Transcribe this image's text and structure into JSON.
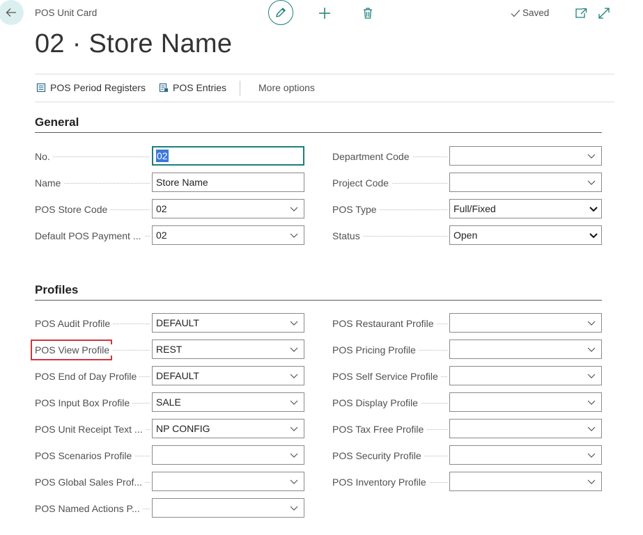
{
  "header": {
    "caption": "POS Unit Card",
    "saved_label": "Saved",
    "title": "02 · Store Name"
  },
  "actions": [
    {
      "label": "POS Period Registers",
      "icon": "register-icon"
    },
    {
      "label": "POS Entries",
      "icon": "entries-icon"
    },
    {
      "label": "More options"
    }
  ],
  "general": {
    "title": "General",
    "left": [
      {
        "label": "No.",
        "value_selected": "02",
        "kind": "text-focused"
      },
      {
        "label": "Name",
        "value": "Store Name",
        "kind": "text"
      },
      {
        "label": "POS Store Code",
        "value": "02",
        "kind": "lookup"
      },
      {
        "label": "Default POS Payment ...",
        "value": "02",
        "kind": "lookup"
      }
    ],
    "right": [
      {
        "label": "Department Code",
        "value": "",
        "kind": "lookup"
      },
      {
        "label": "Project Code",
        "value": "",
        "kind": "lookup"
      },
      {
        "label": "POS Type",
        "value": "Full/Fixed",
        "kind": "select"
      },
      {
        "label": "Status",
        "value": "Open",
        "kind": "select"
      }
    ]
  },
  "profiles": {
    "title": "Profiles",
    "left": [
      {
        "label": "POS Audit Profile",
        "value": "DEFAULT"
      },
      {
        "label": "POS View Profile",
        "value": "REST"
      },
      {
        "label": "POS End of Day Profile",
        "value": "DEFAULT"
      },
      {
        "label": "POS Input Box Profile",
        "value": "SALE"
      },
      {
        "label": "POS Unit Receipt Text ...",
        "value": "NP CONFIG"
      },
      {
        "label": "POS Scenarios Profile",
        "value": ""
      },
      {
        "label": "POS Global Sales Prof...",
        "value": ""
      },
      {
        "label": "POS Named Actions P...",
        "value": ""
      }
    ],
    "right": [
      {
        "label": "POS Restaurant Profile",
        "value": ""
      },
      {
        "label": "POS Pricing Profile",
        "value": ""
      },
      {
        "label": "POS Self Service Profile",
        "value": ""
      },
      {
        "label": "POS Display Profile",
        "value": ""
      },
      {
        "label": "POS Tax Free Profile",
        "value": ""
      },
      {
        "label": "POS Security Profile",
        "value": ""
      },
      {
        "label": "POS Inventory Profile",
        "value": ""
      }
    ]
  },
  "colors": {
    "accent": "#1b7f7a",
    "highlight_border": "#d0363b",
    "selection": "#3b78d8"
  }
}
